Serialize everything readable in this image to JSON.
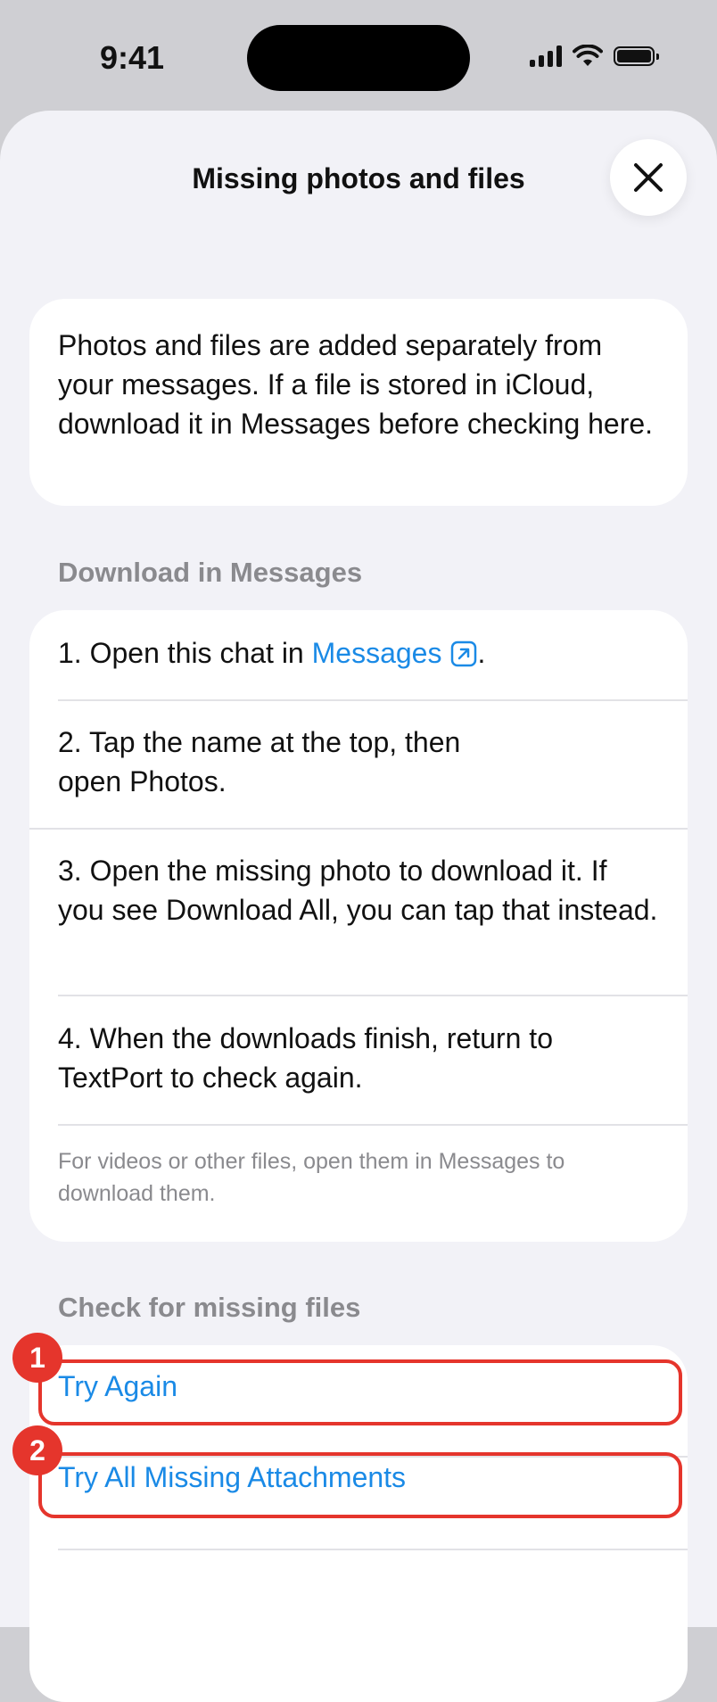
{
  "status_bar": {
    "time": "9:41"
  },
  "sheet": {
    "title": "Missing photos and files"
  },
  "intro": {
    "text": "Photos and files are added separately from your messages. If a file is stored in iCloud, download it in Messages before checking here."
  },
  "download_section": {
    "header": "Download in Messages",
    "step1_prefix": "1. Open this chat in ",
    "step1_link": "Messages",
    "step1_suffix": ".",
    "step2_line1": "2. Tap the name at the top, then",
    "step2_line2": "open Photos.",
    "step3": "3. Open the missing photo to download it. If you see Download All, you can tap that instead.",
    "step4": "4. When the downloads finish, return to TextPort to check again.",
    "footnote": "For videos or other files, open them in Messages to download them."
  },
  "check_section": {
    "header": "Check for missing files",
    "try_again": "Try Again",
    "try_all": "Try All Missing Attachments"
  },
  "annotations": {
    "badge1": "1",
    "badge2": "2"
  },
  "colors": {
    "accent": "#1a8ae6",
    "highlight": "#e5352c",
    "background": "#f2f2f7"
  }
}
